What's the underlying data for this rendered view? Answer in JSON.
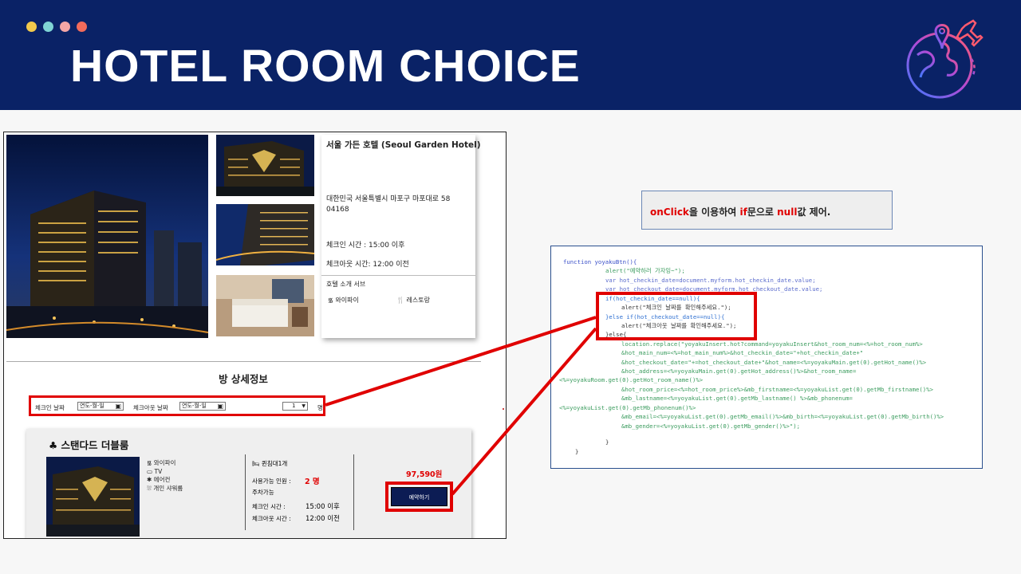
{
  "header": {
    "title": "HOTEL ROOM CHOICE",
    "dot_colors": [
      "#f2c94c",
      "#7fd4d4",
      "#f4a6a6",
      "#f26b5b"
    ],
    "background": "#0a2266"
  },
  "hotel": {
    "name": "서울 가든 호텔 (Seoul Garden Hotel)",
    "address": "대한민국 서울특별시 마포구 마포대로 58 04168",
    "checkin": "체크인 시간 : 15:00 이후",
    "checkout": "체크아웃 시간: 12:00 이전",
    "services_title": "호텔 소개 서브",
    "services": [
      {
        "icon": "wifi-icon",
        "label": "와이파이"
      },
      {
        "icon": "restaurant-icon",
        "label": "레스토랑"
      }
    ]
  },
  "room_section": {
    "title": "방 상세정보",
    "checkin_label": "체크인 날짜",
    "checkin_placeholder": "연도-월-일",
    "checkout_label": "체크아웃 날짜",
    "checkout_placeholder": "연도-월-일",
    "people_value": "1",
    "people_unit": "명"
  },
  "room": {
    "title": "♣ 스탠다드 더블룸",
    "amenities": [
      {
        "icon": "wifi-icon",
        "label": "와이파이"
      },
      {
        "icon": "tv-icon",
        "label": "TV"
      },
      {
        "icon": "aircon-icon",
        "label": "에어컨"
      },
      {
        "icon": "shower-icon",
        "label": "개인 샤워룸"
      }
    ],
    "bed": "퀸침대1개",
    "capacity_label": "사용가능 인원 :",
    "capacity_value": "2 명",
    "parking": "주차가능",
    "checkin_label": "체크인 시간 :",
    "checkin_value": "15:00 이후",
    "checkout_label": "체크아웃 시간 :",
    "checkout_value": "12:00 이전",
    "price": "97,590원",
    "reserve_label": "예약하기"
  },
  "note": {
    "parts": [
      "onClick",
      "을 이용하여 ",
      "if",
      "문으로 ",
      "null",
      "값 제어."
    ]
  },
  "code": {
    "lines": [
      "function yoyakuBtn(){",
      "alert(\"예약하러 가자잉~\");",
      "var hot_checkin_date=document.myform.hot_checkin_date.value;",
      "var hot_checkout_date=document.myform.hot_checkout_date.value;",
      "if(hot_checkin_date==null){",
      "alert(\"체크인 날짜를 확인해주세요.\");",
      "}else if(hot_checkout_date==null){",
      "alert(\"체크아웃 날짜를 확인해주세요.\");",
      "}else{",
      "location.replace(\"yoyakuInsert.hot?command=yoyakuInsert&hot_room_num=<%=hot_room_num%>",
      "&hot_main_num=<%=hot_main_num%>&hot_checkin_date=\"+hot_checkin_date+\"",
      "&hot_checkout_date=\"+=hot_checkout_date+\"&hot_name=<%=yoyakuMain.get(0).getHot_name()%>",
      "&hot_address=<%=yoyakuMain.get(0).getHot_address()%>&hot_room_name=",
      "<%=yoyakuRoom.get(0).getHot_room_name()%>",
      "&hot_room_price=<%=hot_room_price%>&mb_firstname=<%=yoyakuList.get(0).getMb_firstname()%>",
      "&mb_lastname=<%=yoyakuList.get(0).getMb_lastname() %>&mb_phonenum=",
      "<%=yoyakuList.get(0).getMb_phonenum()%>",
      "&mb_email=<%=yoyakuList.get(0).getMb_email()%>&mb_birth=<%=yoyakuList.get(0).getMb_birth()%>",
      "&mb_gender=<%=yoyakuList.get(0).getMb_gender()%>\");",
      "",
      "}",
      "}"
    ]
  },
  "colors": {
    "highlight": "#e00000",
    "button": "#0c1c54"
  }
}
